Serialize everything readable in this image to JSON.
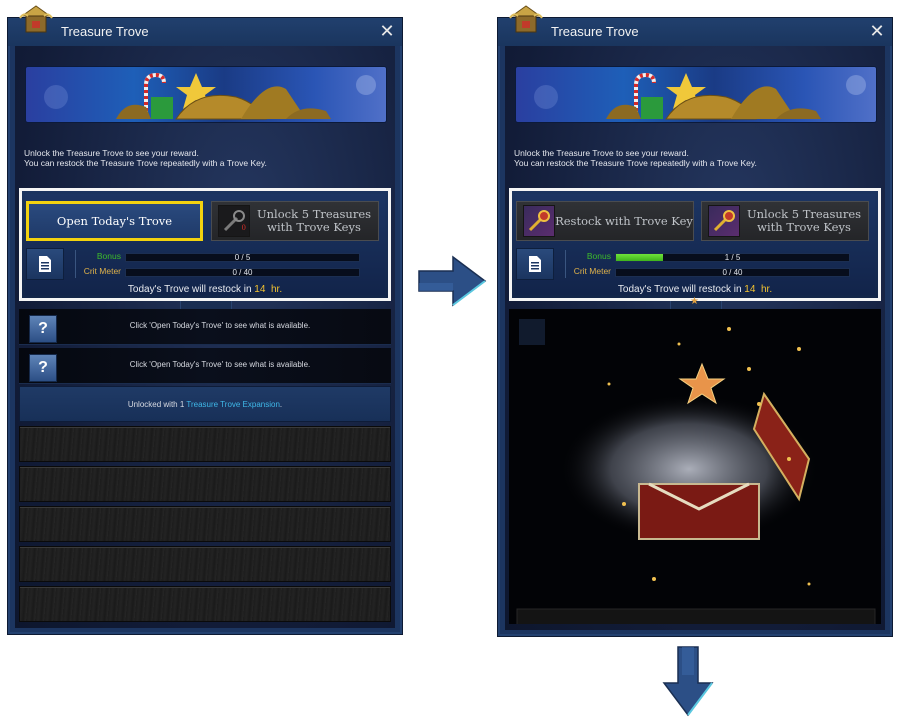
{
  "window": {
    "title": "Treasure Trove",
    "close_icon": "close-icon"
  },
  "intro": {
    "line1": "Unlock the Treasure Trove to see your reward.",
    "line2": "You can restock the Treasure Trove repeatedly with a Trove Key."
  },
  "left_panel": {
    "primary_button": "Open Today's Trove",
    "secondary_button_line1": "Unlock 5 Treasures",
    "secondary_button_line2": "with Trove Keys",
    "key_count": "0",
    "bonus_label": "Bonus",
    "bonus_value": "0 / 5",
    "bonus_progress": 0,
    "crit_label": "Crit Meter",
    "crit_value": "0 / 40",
    "crit_progress": 0,
    "restock_prefix": "Today's Trove will restock in ",
    "restock_hours": "14",
    "restock_suffix": "hr.",
    "rows": [
      {
        "text": "Click 'Open Today's Trove' to see what is available."
      },
      {
        "text": "Click 'Open Today's Trove' to see what is available."
      }
    ],
    "expansion_prefix": "Unlocked with 1 ",
    "expansion_link": "Treasure Trove Expansion",
    "expansion_suffix": ".",
    "locked_rows": 5
  },
  "right_panel": {
    "restock_button": "Restock with Trove Key",
    "secondary_button_line1": "Unlock 5 Treasures",
    "secondary_button_line2": "with Trove Keys",
    "bonus_label": "Bonus",
    "bonus_value": "1 / 5",
    "bonus_progress": 0.2,
    "crit_label": "Crit Meter",
    "crit_value": "0 / 40",
    "crit_progress": 0,
    "restock_prefix": "Today's Trove will restock in ",
    "restock_hours": "14",
    "restock_suffix": "hr.",
    "animation": "chest-opening"
  },
  "colors": {
    "frame": "#1c3560",
    "highlight": "#f2d20f",
    "bonus_label": "#3dbb2a",
    "crit_label": "#e0b24a",
    "hours": "#f2c230",
    "link": "#3fb8e8",
    "candy_red": "#d93b2d"
  }
}
